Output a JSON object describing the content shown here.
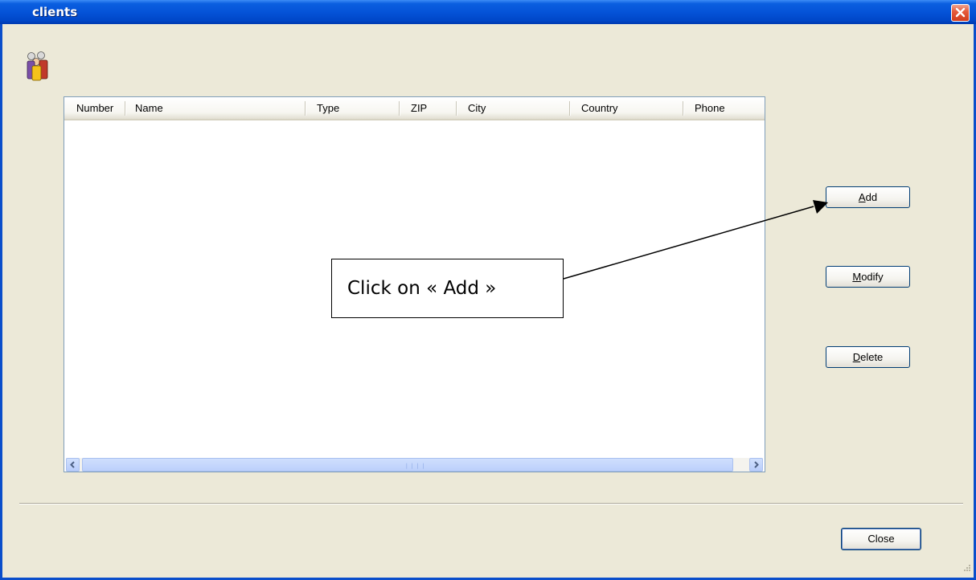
{
  "window": {
    "title": "clients"
  },
  "icons": {
    "app": "users-group-icon",
    "close": "close-x-icon"
  },
  "list": {
    "columns": [
      "Number",
      "Name",
      "Type",
      "ZIP",
      "City",
      "Country",
      "Phone"
    ],
    "rows": []
  },
  "buttons": {
    "add": {
      "mnemonic": "A",
      "rest": "dd"
    },
    "modify": {
      "mnemonic": "M",
      "rest": "odify"
    },
    "delete": {
      "mnemonic": "D",
      "rest": "elete"
    },
    "close": "Close"
  },
  "annotation": {
    "text": "Click on « Add »"
  },
  "colors": {
    "titlebar": "#0553d8",
    "client_bg": "#ece9d8",
    "close_button": "#d23d1c"
  }
}
